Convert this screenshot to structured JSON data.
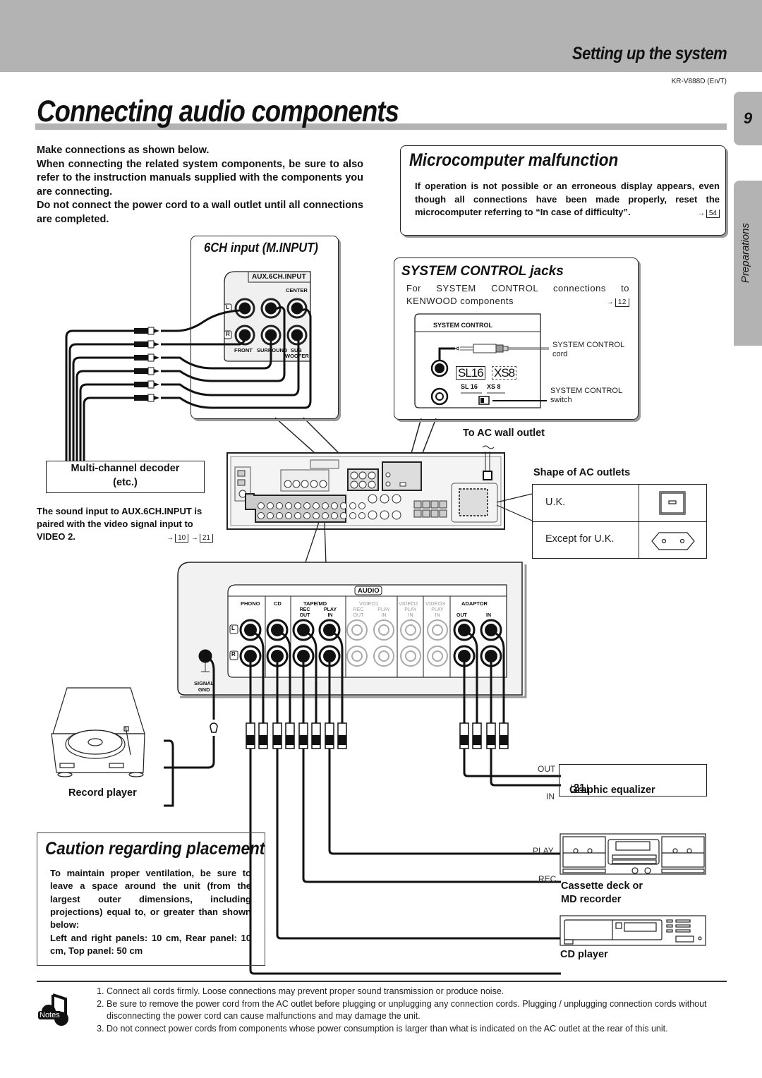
{
  "header": {
    "section_title": "Setting up the system",
    "model_code": "KR-V888D (En/T)",
    "page_title": "Connecting audio components",
    "page_number": "9",
    "side_tab": "Preparations"
  },
  "intro": {
    "line1": "Make connections as shown below.",
    "line2": "When connecting the related system components, be sure to also refer to the instruction manuals supplied with the components you are connecting.",
    "line3": "Do not connect the power cord to a wall outlet until all connections are completed."
  },
  "microcomputer": {
    "title": "Microcomputer malfunction",
    "body": "If operation is not possible or an erroneous display appears, even though all connections have been made properly, reset the microcomputer referring to “In case of difficulty”.",
    "ref_page": "54"
  },
  "six_ch": {
    "title": "6CH input (M.INPUT)",
    "panel_label": "AUX.6CH.INPUT",
    "center_label": "CENTER",
    "left_marker": "L",
    "right_marker": "R",
    "front_label": "FRONT",
    "surround_label": "SURROUND",
    "sub_label": "SUB",
    "woofer_label": "WOOFER"
  },
  "system_control": {
    "title": "SYSTEM CONTROL  jacks",
    "desc": "For SYSTEM CONTROL connections to KENWOOD components",
    "ref_page": "12",
    "panel_label": "SYSTEM CONTROL",
    "cord_label_1": "SYSTEM CONTROL",
    "cord_label_2": "cord",
    "switch_label_1": "SYSTEM CONTROL",
    "switch_label_2": "switch",
    "sl16_display": "SL16",
    "xs8_display": "XS8",
    "sl16_label": "SL 16",
    "xs8_label": "XS 8"
  },
  "decoder": {
    "line1": "Multi-channel decoder",
    "line2": "(etc.)"
  },
  "aux_note": {
    "text": "The sound input to AUX.6CH.INPUT is paired with the video signal input to VIDEO 2.",
    "ref_pages": [
      "10",
      "21"
    ]
  },
  "ac": {
    "wall_outlet": "To AC wall outlet",
    "shape_title": "Shape of AC outlets",
    "rows": [
      {
        "label": "U.K.",
        "icon": "uk-outlet-icon"
      },
      {
        "label": "Except for U.K.",
        "icon": "euro-outlet-icon"
      }
    ]
  },
  "audio_panel": {
    "title": "AUDIO",
    "columns": [
      {
        "name": "PHONO",
        "sub": [
          ""
        ],
        "active": true
      },
      {
        "name": "CD",
        "sub": [
          ""
        ],
        "active": true
      },
      {
        "name": "TAPE/MD",
        "sub": [
          "REC OUT",
          "PLAY IN"
        ],
        "active": true
      },
      {
        "name": "VIDEO1",
        "sub": [
          "REC OUT",
          "PLAY IN"
        ],
        "active": false
      },
      {
        "name": "VIDEO2",
        "sub": [
          "PLAY IN"
        ],
        "active": false
      },
      {
        "name": "VIDEO3",
        "sub": [
          "PLAY IN"
        ],
        "active": false
      },
      {
        "name": "ADAPTOR",
        "sub": [
          "OUT",
          "IN"
        ],
        "active": true
      }
    ],
    "left_marker": "L",
    "right_marker": "R",
    "gnd_label_1": "SIGNAL",
    "gnd_label_2": "GND"
  },
  "components": {
    "record_player": "Record player",
    "graphic_eq": "Graphic equalizer",
    "graphic_eq_ref": "21",
    "geq_out": "OUT",
    "geq_in": "IN",
    "cassette_1": "Cassette deck or",
    "cassette_2": "MD recorder",
    "cassette_play": "PLAY",
    "cassette_rec": "REC",
    "cd_player": "CD player"
  },
  "caution": {
    "title": "Caution regarding placement",
    "body": "To maintain proper ventilation, be sure to leave a space around the unit (from the largest outer dimensions, including projections) equal to, or greater than shown below:",
    "dims": "Left and right panels: 10 cm, Rear panel: 10 cm, Top panel: 50 cm"
  },
  "notes": {
    "icon_label": "Notes",
    "items": [
      "Connect all cords firmly. Loose connections may prevent proper sound transmission or produce noise.",
      "Be sure to remove the power cord from the AC outlet before plugging or unplugging any connection cords. Plugging / unplugging connection cords without disconnecting the power cord can cause malfunctions and may damage the unit.",
      "Do not connect power cords from components whose power consumption is larger than what is indicated on the AC outlet at the rear of this unit."
    ]
  }
}
